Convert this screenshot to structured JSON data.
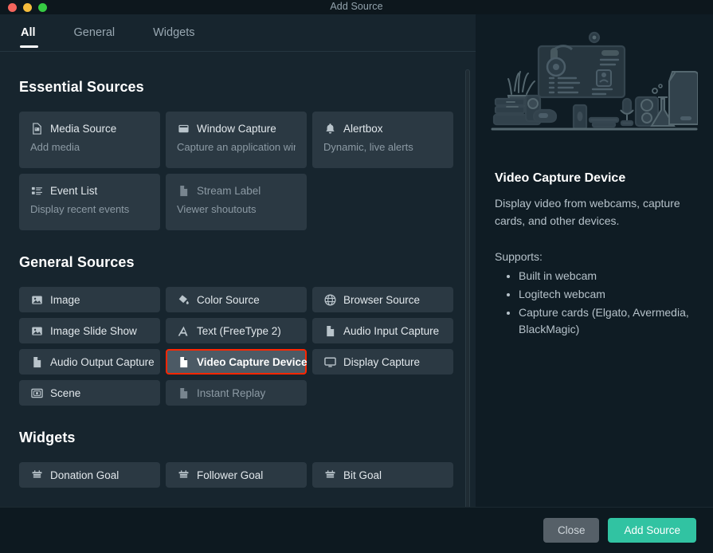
{
  "window": {
    "title": "Add Source",
    "controls": [
      "close",
      "minimize",
      "maximize"
    ]
  },
  "tabs": [
    {
      "label": "All",
      "active": true
    },
    {
      "label": "General",
      "active": false
    },
    {
      "label": "Widgets",
      "active": false
    }
  ],
  "sections": [
    {
      "title": "Essential Sources",
      "layout": "detailed",
      "items": [
        {
          "name": "Media Source",
          "desc": "Add media",
          "icon": "media-file-icon"
        },
        {
          "name": "Window Capture",
          "desc": "Capture an application window",
          "icon": "window-icon"
        },
        {
          "name": "Alertbox",
          "desc": "Dynamic, live alerts",
          "icon": "bell-icon"
        },
        {
          "name": "Event List",
          "desc": "Display recent events",
          "icon": "list-icon"
        },
        {
          "name": "Stream Label",
          "desc": "Viewer shoutouts",
          "icon": "file-icon",
          "muted": true
        }
      ]
    },
    {
      "title": "General Sources",
      "layout": "compact",
      "items": [
        {
          "name": "Image",
          "icon": "image-icon"
        },
        {
          "name": "Color Source",
          "icon": "paint-bucket-icon"
        },
        {
          "name": "Browser Source",
          "icon": "globe-icon"
        },
        {
          "name": "Image Slide Show",
          "icon": "image-icon"
        },
        {
          "name": "Text (FreeType 2)",
          "icon": "text-a-icon"
        },
        {
          "name": "Audio Input Capture",
          "icon": "file-icon"
        },
        {
          "name": "Audio Output Capture",
          "icon": "file-icon"
        },
        {
          "name": "Video Capture Device",
          "icon": "file-icon",
          "selected": true
        },
        {
          "name": "Display Capture",
          "icon": "monitor-icon"
        },
        {
          "name": "Scene",
          "icon": "scene-icon"
        },
        {
          "name": "Instant Replay",
          "icon": "file-icon",
          "muted": true
        }
      ]
    },
    {
      "title": "Widgets",
      "layout": "compact",
      "items": [
        {
          "name": "Donation Goal",
          "icon": "goal-icon"
        },
        {
          "name": "Follower Goal",
          "icon": "goal-icon"
        },
        {
          "name": "Bit Goal",
          "icon": "goal-icon"
        }
      ]
    }
  ],
  "details": {
    "title": "Video Capture Device",
    "description": "Display video from webcams, capture cards, and other devices.",
    "supports_label": "Supports:",
    "supports": [
      "Built in webcam",
      "Logitech webcam",
      "Capture cards (Elgato, Avermedia, BlackMagic)"
    ]
  },
  "footer": {
    "close_label": "Close",
    "add_label": "Add Source"
  },
  "colors": {
    "accent": "#31c3a2",
    "highlight_border": "#ff2600",
    "card_bg": "#2b3943",
    "selected_bg": "#4c5a65",
    "panel_bg": "#0f1c24",
    "app_bg": "#17252e"
  }
}
